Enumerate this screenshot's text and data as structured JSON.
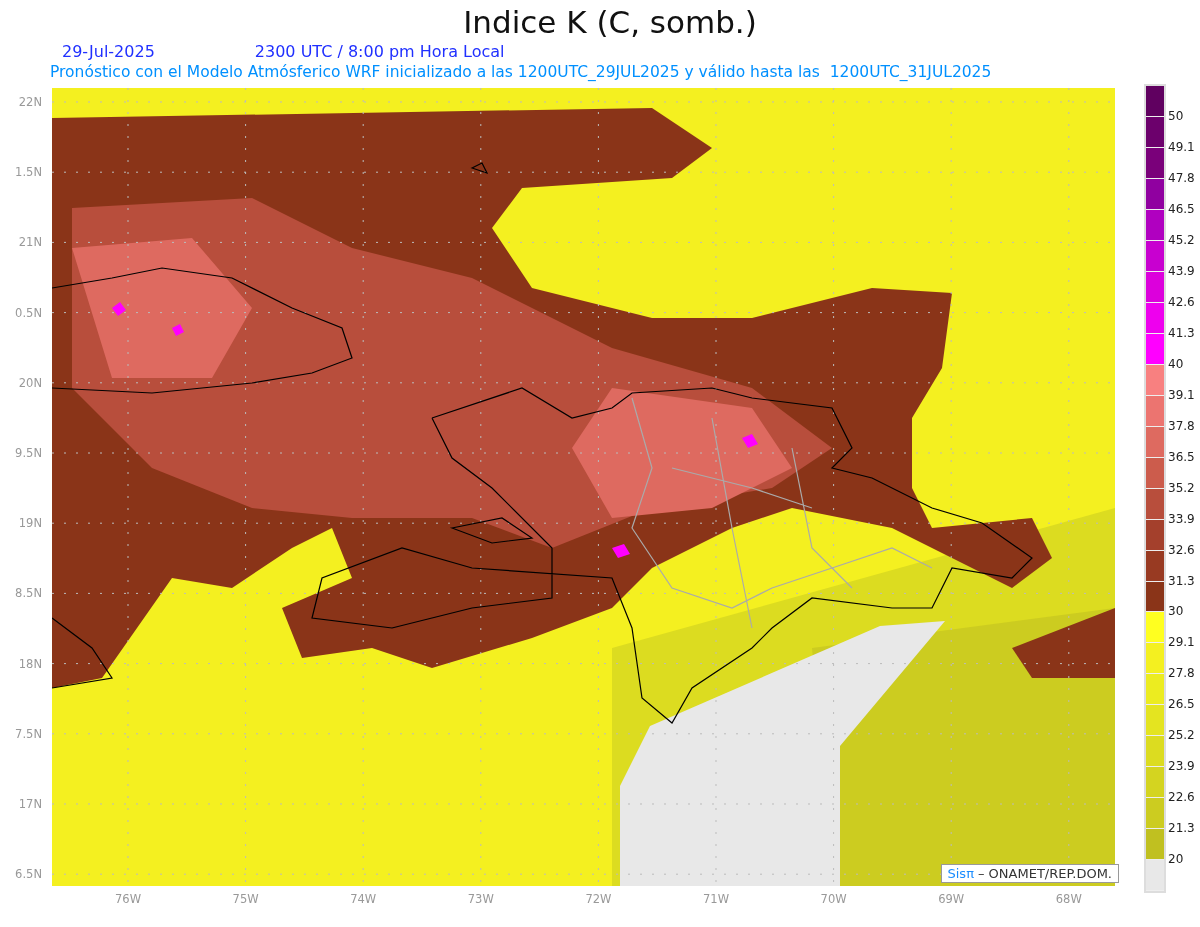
{
  "title": "Indice K (C, somb.)",
  "date": "29-Jul-2025",
  "time": "2300 UTC / 8:00 pm Hora Local",
  "subtitle": "Pronóstico con el Modelo Atmósferico WRF inicializado a las 1200UTC_29JUL2025 y válido hasta las  1200UTC_31JUL2025",
  "map": {
    "lat_labels": [
      "22N",
      "1.5N",
      "21N",
      "0.5N",
      "20N",
      "9.5N",
      "19N",
      "8.5N",
      "18N",
      "7.5N",
      "17N",
      "6.5N"
    ],
    "lon_labels": [
      "76W",
      "75W",
      "74W",
      "73W",
      "72W",
      "71W",
      "70W",
      "69W",
      "68W"
    ],
    "credit": {
      "brand": "Sisπ",
      "text": "– ONAMET/REP.DOM."
    }
  },
  "legend": [
    {
      "color": "#600060",
      "label": "50"
    },
    {
      "color": "#6c006c",
      "label": "49.1"
    },
    {
      "color": "#7a007a",
      "label": "47.8"
    },
    {
      "color": "#9000a0",
      "label": "46.5"
    },
    {
      "color": "#b000c0",
      "label": "45.2"
    },
    {
      "color": "#c800d0",
      "label": "43.9"
    },
    {
      "color": "#dc00dc",
      "label": "42.6"
    },
    {
      "color": "#ee00ee",
      "label": "41.3"
    },
    {
      "color": "#ff00ff",
      "label": "40"
    },
    {
      "color": "#f88080",
      "label": "39.1"
    },
    {
      "color": "#ec7470",
      "label": "37.8"
    },
    {
      "color": "#de6a60",
      "label": "36.5"
    },
    {
      "color": "#cc5c4c",
      "label": "35.2"
    },
    {
      "color": "#b84e3c",
      "label": "33.9"
    },
    {
      "color": "#a4402c",
      "label": "32.6"
    },
    {
      "color": "#983a22",
      "label": "31.3"
    },
    {
      "color": "#8a3418",
      "label": "30"
    },
    {
      "color": "#ffff20",
      "label": "29.1"
    },
    {
      "color": "#f4f020",
      "label": "27.8"
    },
    {
      "color": "#ecec20",
      "label": "26.5"
    },
    {
      "color": "#e4e420",
      "label": "25.2"
    },
    {
      "color": "#dcdc20",
      "label": "23.9"
    },
    {
      "color": "#d4d420",
      "label": "22.6"
    },
    {
      "color": "#cccc20",
      "label": "21.3"
    },
    {
      "color": "#c0c020",
      "label": "20"
    },
    {
      "color": "#e8e8e8"
    }
  ]
}
